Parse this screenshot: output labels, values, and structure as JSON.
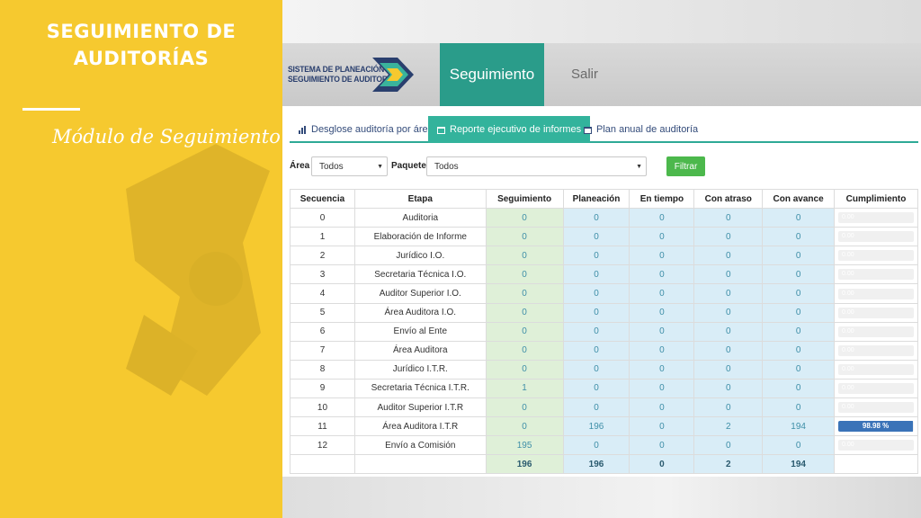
{
  "slide": {
    "title_line1": "SEGUIMIENTO DE",
    "title_line2": "AUDITORÍAS",
    "subtitle": "Módulo de Seguimiento"
  },
  "header": {
    "logo_line1": "SISTEMA DE PLANEACIÓN Y",
    "logo_line2": "SEGUIMIENTO DE AUDITORÍAS",
    "nav_active": "Seguimiento",
    "nav_exit": "Salir"
  },
  "tabs": [
    {
      "label": "Desglose auditoría por área",
      "icon": "bar-chart-icon"
    },
    {
      "label": "Reporte ejecutivo de informes",
      "icon": "calendar-icon"
    },
    {
      "label": "Plan anual de auditoría",
      "icon": "calendar-icon"
    }
  ],
  "filters": {
    "area_label": "Área",
    "area_value": "Todos",
    "paquete_label": "Paquete",
    "paquete_value": "Todos",
    "button": "Filtrar"
  },
  "table": {
    "headers": [
      "Secuencia",
      "Etapa",
      "Seguimiento",
      "Planeación",
      "En tiempo",
      "Con atraso",
      "Con avance",
      "Cumplimiento"
    ],
    "rows": [
      {
        "seq": "0",
        "etapa": "Auditoria",
        "seg": "0",
        "plan": "0",
        "tiempo": "0",
        "atraso": "0",
        "avance": "0",
        "cumpl": 0,
        "cumpl_label": "0.00"
      },
      {
        "seq": "1",
        "etapa": "Elaboración de Informe",
        "seg": "0",
        "plan": "0",
        "tiempo": "0",
        "atraso": "0",
        "avance": "0",
        "cumpl": 0,
        "cumpl_label": "0.00"
      },
      {
        "seq": "2",
        "etapa": "Jurídico I.O.",
        "seg": "0",
        "plan": "0",
        "tiempo": "0",
        "atraso": "0",
        "avance": "0",
        "cumpl": 0,
        "cumpl_label": "0.00"
      },
      {
        "seq": "3",
        "etapa": "Secretaria Técnica I.O.",
        "seg": "0",
        "plan": "0",
        "tiempo": "0",
        "atraso": "0",
        "avance": "0",
        "cumpl": 0,
        "cumpl_label": "0.00"
      },
      {
        "seq": "4",
        "etapa": "Auditor Superior I.O.",
        "seg": "0",
        "plan": "0",
        "tiempo": "0",
        "atraso": "0",
        "avance": "0",
        "cumpl": 0,
        "cumpl_label": "0.00"
      },
      {
        "seq": "5",
        "etapa": "Área Auditora I.O.",
        "seg": "0",
        "plan": "0",
        "tiempo": "0",
        "atraso": "0",
        "avance": "0",
        "cumpl": 0,
        "cumpl_label": "0.00"
      },
      {
        "seq": "6",
        "etapa": "Envío al Ente",
        "seg": "0",
        "plan": "0",
        "tiempo": "0",
        "atraso": "0",
        "avance": "0",
        "cumpl": 0,
        "cumpl_label": "0.00"
      },
      {
        "seq": "7",
        "etapa": "Área Auditora",
        "seg": "0",
        "plan": "0",
        "tiempo": "0",
        "atraso": "0",
        "avance": "0",
        "cumpl": 0,
        "cumpl_label": "0.00"
      },
      {
        "seq": "8",
        "etapa": "Jurídico I.T.R.",
        "seg": "0",
        "plan": "0",
        "tiempo": "0",
        "atraso": "0",
        "avance": "0",
        "cumpl": 0,
        "cumpl_label": "0.00"
      },
      {
        "seq": "9",
        "etapa": "Secretaria Técnica I.T.R.",
        "seg": "1",
        "plan": "0",
        "tiempo": "0",
        "atraso": "0",
        "avance": "0",
        "cumpl": 0,
        "cumpl_label": "0.00"
      },
      {
        "seq": "10",
        "etapa": "Auditor Superior I.T.R",
        "seg": "0",
        "plan": "0",
        "tiempo": "0",
        "atraso": "0",
        "avance": "0",
        "cumpl": 0,
        "cumpl_label": "0.00"
      },
      {
        "seq": "11",
        "etapa": "Área Auditora I.T.R",
        "seg": "0",
        "plan": "196",
        "tiempo": "0",
        "atraso": "2",
        "avance": "194",
        "cumpl": 98.98,
        "cumpl_label": "98.98 %"
      },
      {
        "seq": "12",
        "etapa": "Envío a Comisión",
        "seg": "195",
        "plan": "0",
        "tiempo": "0",
        "atraso": "0",
        "avance": "0",
        "cumpl": 0,
        "cumpl_label": "0.00"
      }
    ],
    "totals": {
      "seg": "196",
      "plan": "196",
      "tiempo": "0",
      "atraso": "2",
      "avance": "194"
    }
  },
  "colors": {
    "yellow_panel": "#f6c92f",
    "teal_active": "#2a9c8a",
    "tab_active": "#33b39c",
    "filter_button": "#4cb84c",
    "progress_fill": "#3a73b8",
    "seg_cell": "#dff0d8",
    "info_cell": "#d9edf7"
  }
}
